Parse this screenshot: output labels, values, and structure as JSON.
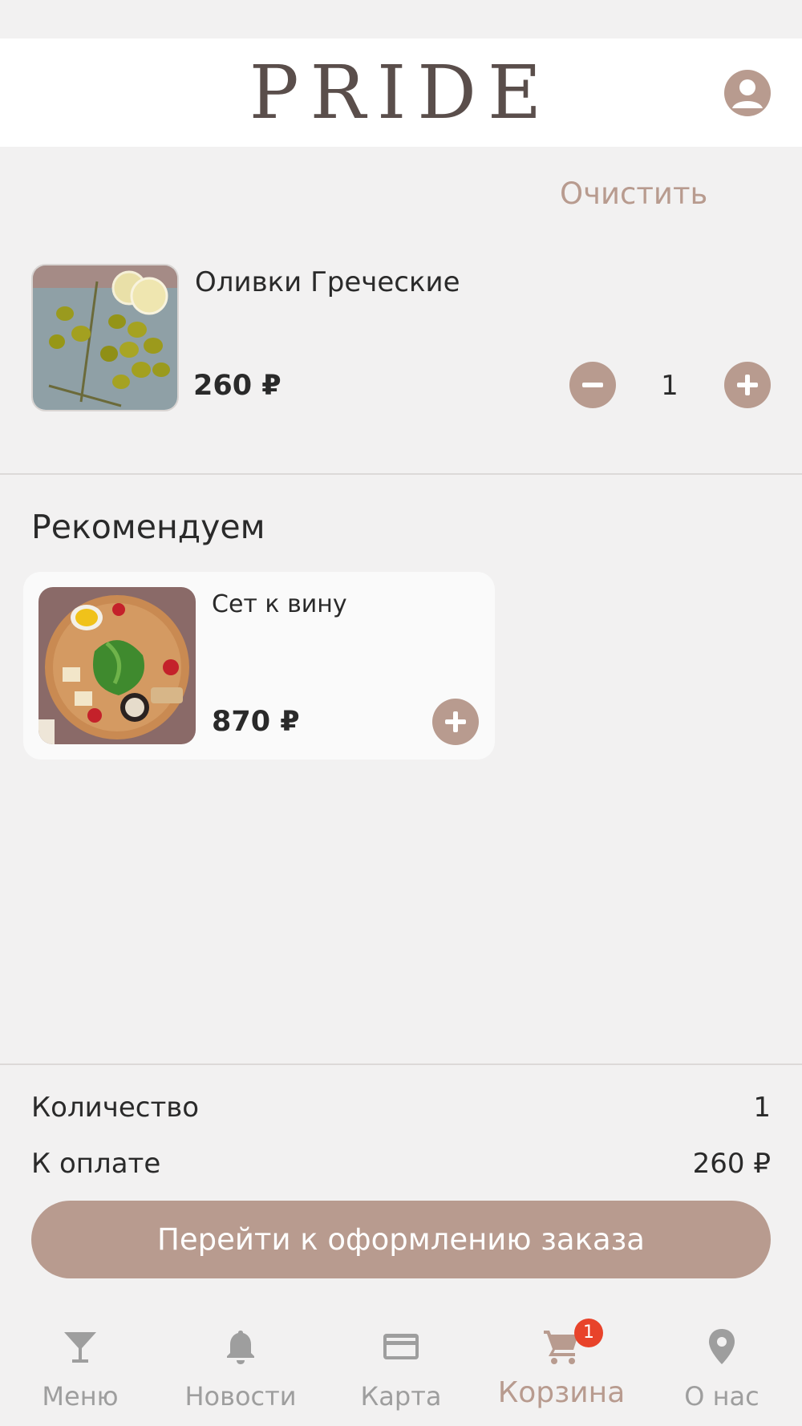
{
  "header": {
    "brand": "PRIDE",
    "profile_icon": "account-circle-icon"
  },
  "cart": {
    "clear_label": "Очистить",
    "items": [
      {
        "name": "Оливки Греческие",
        "price": "260 ₽",
        "quantity": "1"
      }
    ]
  },
  "recommend": {
    "title": "Рекомендуем",
    "items": [
      {
        "name": "Сет к вину",
        "price": "870 ₽"
      }
    ]
  },
  "summary": {
    "count_label": "Количество",
    "count_value": "1",
    "total_label": "К оплате",
    "total_value": "260 ₽",
    "checkout_label": "Перейти к оформлению заказа"
  },
  "tabbar": {
    "items": [
      {
        "label": "Меню",
        "icon": "cocktail-glass-icon",
        "active": false
      },
      {
        "label": "Новости",
        "icon": "bell-icon",
        "active": false
      },
      {
        "label": "Карта",
        "icon": "credit-card-icon",
        "active": false
      },
      {
        "label": "Корзина",
        "icon": "cart-icon",
        "active": true,
        "badge": "1"
      },
      {
        "label": "О нас",
        "icon": "location-pin-icon",
        "active": false
      }
    ]
  },
  "colors": {
    "accent": "#b89b8f",
    "badge": "#e8432a",
    "background": "#f2f1f1"
  }
}
